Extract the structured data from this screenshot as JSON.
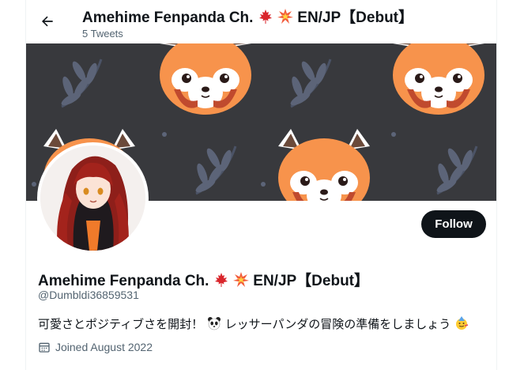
{
  "header": {
    "title_name": "Amehime Fenpanda Ch.",
    "title_suffix": "EN/JP【Debut】",
    "tweet_count": "5 Tweets"
  },
  "profile": {
    "display_name": "Amehime Fenpanda Ch.",
    "display_name_suffix": "EN/JP【Debut】",
    "handle": "@Dumbldi36859531",
    "bio_part1": "可愛さとポジティブさを開封！",
    "bio_part2": "レッサーパンダの冒険の準備をしましょう",
    "joined": "Joined August 2022",
    "follow_label": "Follow"
  },
  "icons": {
    "back": "back-arrow-icon",
    "maple": "maple-leaf-icon",
    "collision": "collision-icon",
    "panda": "panda-icon",
    "party": "party-face-icon",
    "calendar": "calendar-icon"
  },
  "colors": {
    "text": "#0f1419",
    "secondary": "#536471",
    "button_bg": "#0f1419",
    "banner_bg": "#38393d",
    "panda_orange": "#f7934c",
    "leaf": "#5c6478"
  }
}
